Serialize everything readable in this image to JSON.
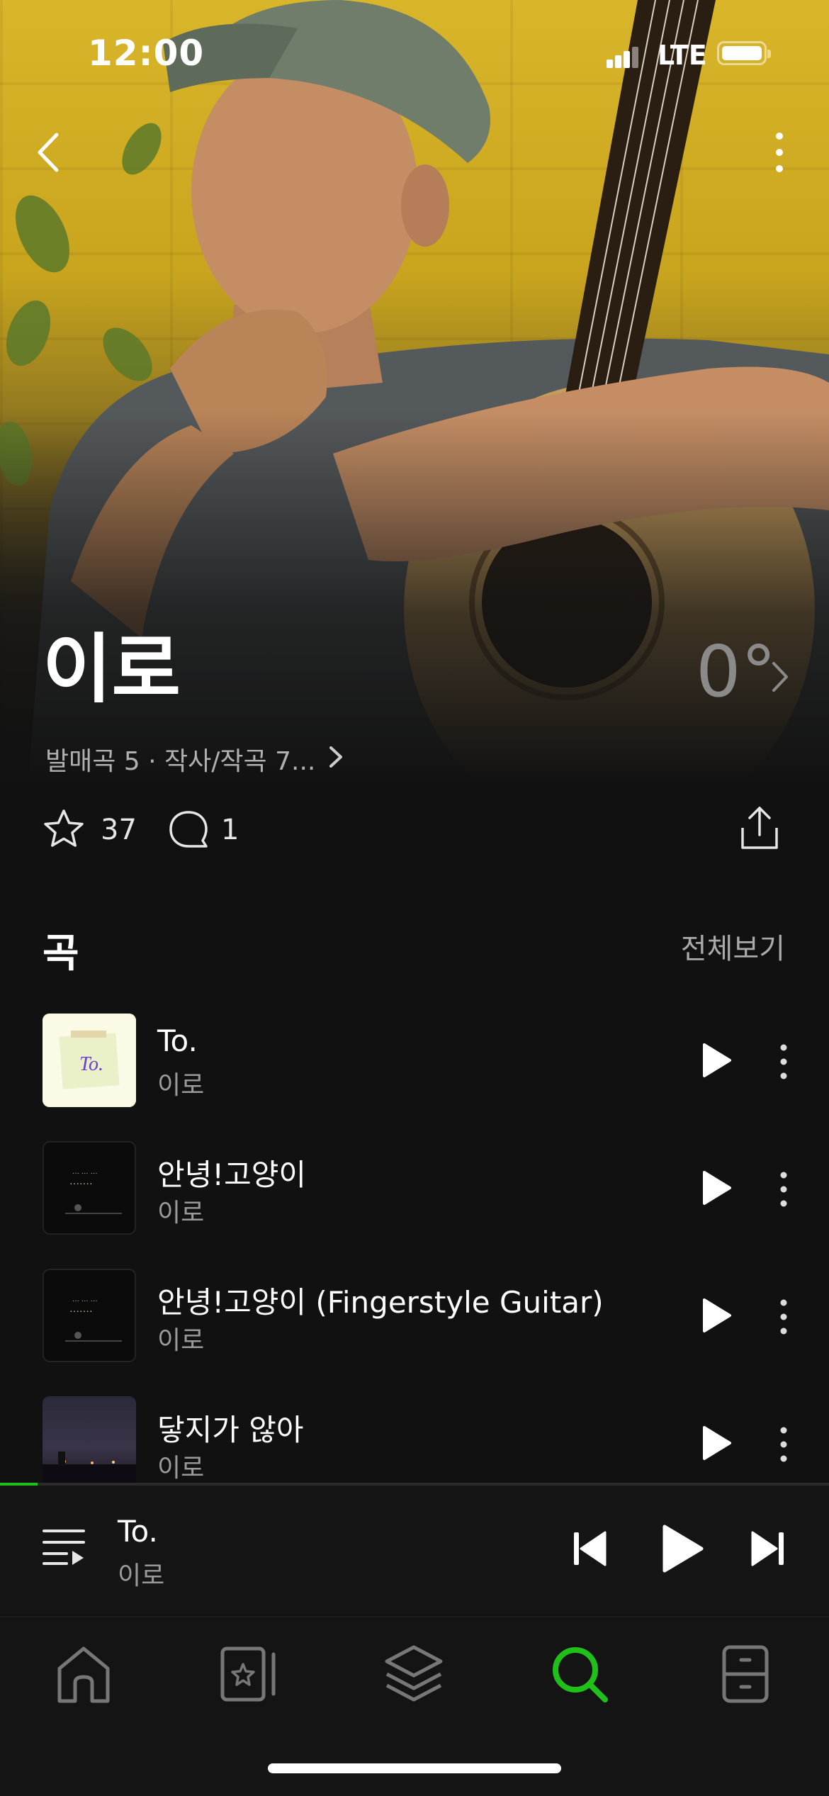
{
  "status": {
    "time": "12:00",
    "network": "LTE"
  },
  "artist": {
    "name": "이로",
    "temperature": "0°",
    "meta": "발매곡 5 · 작사/작곡 7...",
    "likes": "37",
    "comments": "1"
  },
  "songs_section": {
    "title": "곡",
    "see_all": "전체보기",
    "tracks": [
      {
        "title": "To.",
        "artist": "이로",
        "art": "note"
      },
      {
        "title": "안녕!고양이",
        "artist": "이로",
        "art": "dark"
      },
      {
        "title": "안녕!고양이 (Fingerstyle Guitar)",
        "artist": "이로",
        "art": "dark"
      },
      {
        "title": "닿지가 않아",
        "artist": "이로",
        "art": "night"
      }
    ]
  },
  "now_playing": {
    "title": "To.",
    "artist": "이로",
    "progress": 0.045
  },
  "tabs": [
    {
      "name": "home",
      "icon": "home-icon",
      "active": false
    },
    {
      "name": "library",
      "icon": "library-icon",
      "active": false
    },
    {
      "name": "layers",
      "icon": "layers-icon",
      "active": false
    },
    {
      "name": "search",
      "icon": "search-icon",
      "active": true
    },
    {
      "name": "storage",
      "icon": "cabinet-icon",
      "active": false
    }
  ],
  "colors": {
    "accent": "#20c01a",
    "background": "#111111",
    "wall": "#d4b024"
  }
}
